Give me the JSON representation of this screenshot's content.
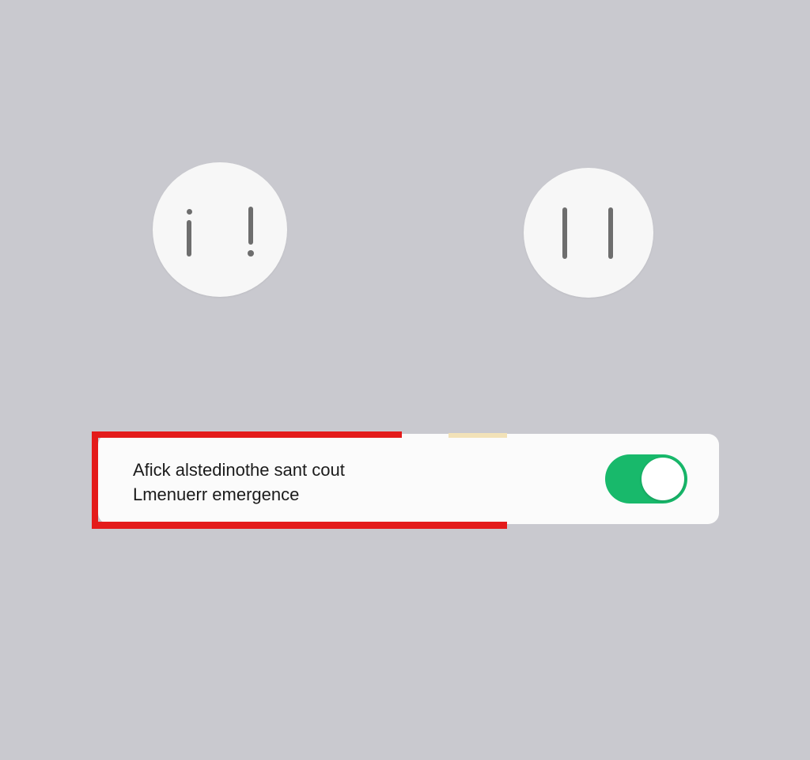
{
  "top_controls": {
    "left_button_icon": "info-alert-icon",
    "right_button_icon": "pause-icon"
  },
  "setting_card": {
    "line1": "Afick alstedinothe sant cout",
    "line2": "Lmenuerr emergence",
    "toggle_state": "on",
    "toggle_color": "#18b96b",
    "highlight_color": "#e41b1b"
  }
}
